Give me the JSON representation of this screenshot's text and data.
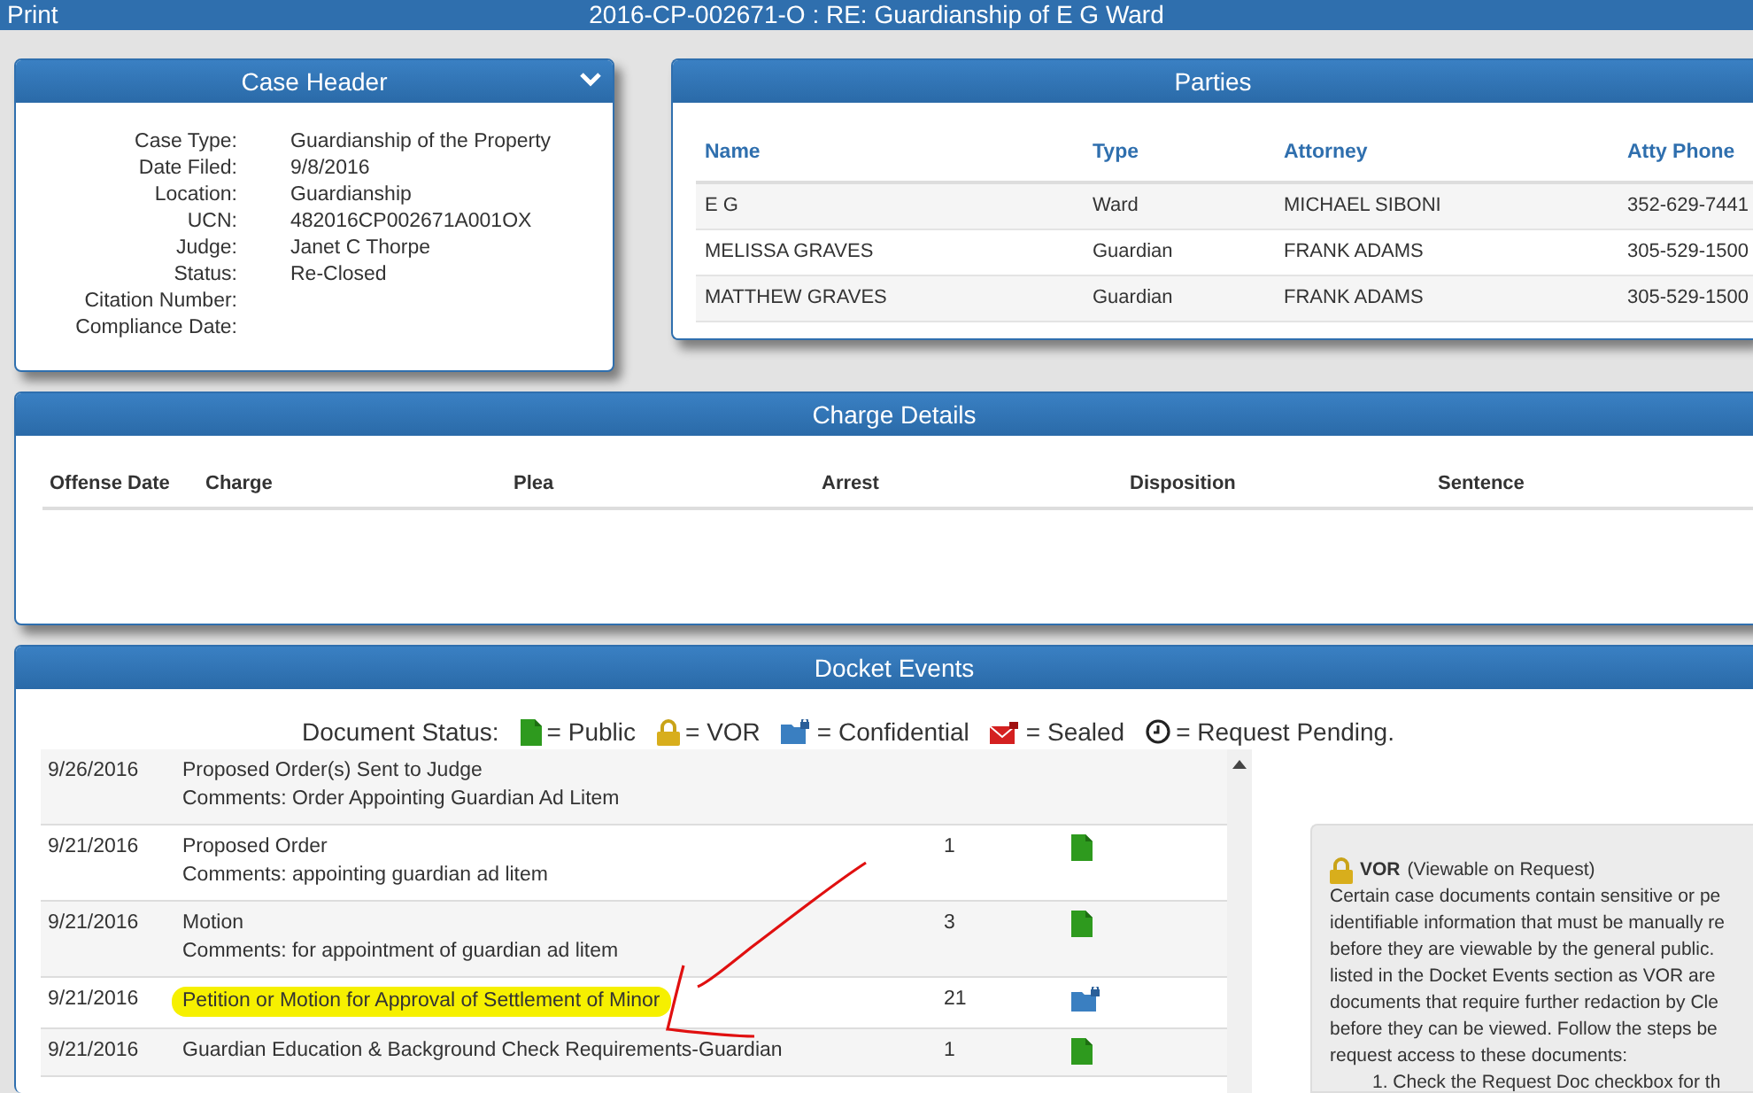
{
  "title_bar": {
    "left": "Print",
    "title": "2016-CP-002671-O : RE: Guardianship of E G Ward"
  },
  "case_header": {
    "title": "Case Header",
    "fields": [
      {
        "label": "Case Type:",
        "value": "Guardianship of the Property"
      },
      {
        "label": "Date Filed:",
        "value": "9/8/2016"
      },
      {
        "label": "Location:",
        "value": "Guardianship"
      },
      {
        "label": "UCN:",
        "value": "482016CP002671A001OX"
      },
      {
        "label": "Judge:",
        "value": "Janet C Thorpe"
      },
      {
        "label": "Status:",
        "value": "Re-Closed"
      },
      {
        "label": "Citation Number:"
      },
      {
        "label": "Compliance Date:"
      }
    ]
  },
  "parties": {
    "title": "Parties",
    "columns": [
      "Name",
      "Type",
      "Attorney",
      "Atty Phone"
    ],
    "rows": [
      [
        "E G",
        "Ward",
        "MICHAEL SIBONI",
        "352-629-7441"
      ],
      [
        "MELISSA GRAVES",
        "Guardian",
        "FRANK ADAMS",
        "305-529-1500"
      ],
      [
        "MATTHEW GRAVES",
        "Guardian",
        "FRANK ADAMS",
        "305-529-1500"
      ]
    ]
  },
  "charge_details": {
    "title": "Charge Details",
    "columns": [
      "Offense Date",
      "Charge",
      "Plea",
      "Arrest",
      "Disposition",
      "Sentence"
    ]
  },
  "docket_events": {
    "title": "Docket Events",
    "legend": {
      "label": "Document Status:",
      "items": [
        {
          "kind": "public",
          "text": "= Public"
        },
        {
          "kind": "vor",
          "text": "= VOR"
        },
        {
          "kind": "confidential",
          "text": "= Confidential"
        },
        {
          "kind": "sealed",
          "text": "= Sealed"
        },
        {
          "kind": "pending",
          "text": "= Request Pending."
        }
      ]
    },
    "rows": [
      {
        "date": "9/26/2016",
        "description": "Proposed Order(s) Sent to Judge",
        "comments": "Comments: Order Appointing Guardian Ad Litem",
        "highlighted": false
      },
      {
        "date": "9/21/2016",
        "description": "Proposed Order",
        "comments": "Comments: appointing guardian ad litem",
        "count": "1",
        "kind": "public",
        "highlighted": false
      },
      {
        "date": "9/21/2016",
        "description": "Motion",
        "comments": "Comments: for appointment of guardian ad litem",
        "count": "3",
        "kind": "public",
        "highlighted": false
      },
      {
        "date": "9/21/2016",
        "description": "Petition or Motion for Approval of Settlement of Minor",
        "count": "21",
        "kind": "confidential",
        "highlighted": true
      },
      {
        "date": "9/21/2016",
        "description": "Guardian Education & Background Check Requirements-Guardian",
        "count": "1",
        "kind": "public",
        "highlighted": false
      }
    ],
    "vor_info": {
      "title": "VOR",
      "subtitle": "(Viewable on Request)",
      "lines": [
        "Certain case documents contain sensitive or pe",
        "identifiable information that must be manually re",
        "before they are viewable by the general public.",
        "listed in the Docket Events section as VOR are",
        "documents that require further redaction by Cle",
        "before they can be viewed. Follow the steps be",
        "request access to these documents:"
      ],
      "steps": [
        "1. Check the Request Doc checkbox for th"
      ]
    }
  }
}
